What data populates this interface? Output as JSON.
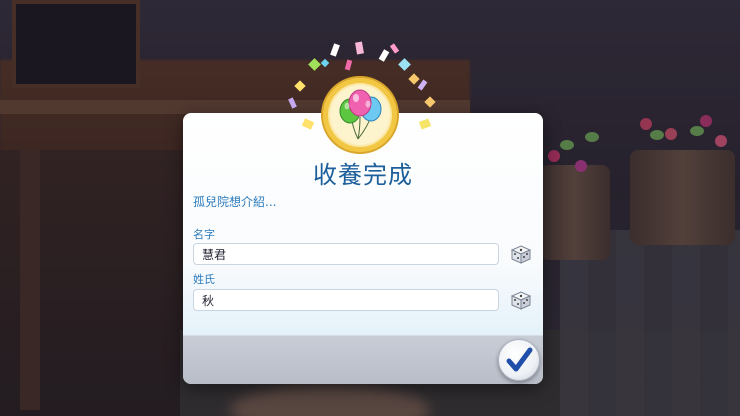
{
  "dialog": {
    "title": "收養完成",
    "subtitle": "孤兒院想介紹...",
    "first_name": {
      "label": "名字",
      "value": "慧君"
    },
    "last_name": {
      "label": "姓氏",
      "value": "秋"
    }
  },
  "icons": {
    "emblem": "balloons-icon",
    "randomize": "dice-icon",
    "confirm": "checkmark-icon"
  },
  "colors": {
    "title": "#1d5f9a",
    "label": "#2b7bbd",
    "checkmark": "#1f4fa8",
    "emblem_gold": "#f2c744"
  }
}
